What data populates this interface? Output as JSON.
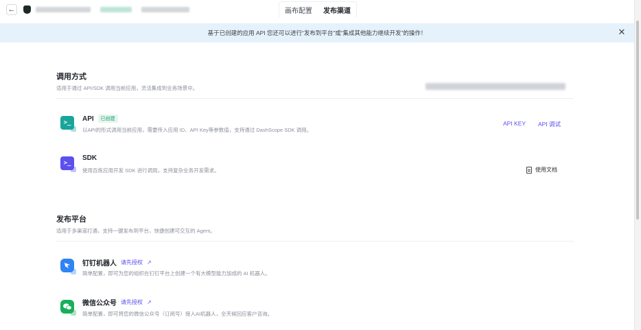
{
  "header": {
    "back_glyph": "←",
    "tabs": [
      {
        "label": "画布配置",
        "active": false
      },
      {
        "label": "发布渠道",
        "active": true
      }
    ]
  },
  "banner": {
    "text": "基于已创建的应用 API 您还可以进行“发布到平台”或“集成其他能力继续开发”的操作！",
    "close_glyph": "✕"
  },
  "invoke_section": {
    "title": "调用方式",
    "desc": "适用于通过 API/SDK 调用当前应用，灵活集成到业务场景中。",
    "items": [
      {
        "icon": "terminal-icon",
        "icon_glyph": ">_",
        "title": "API",
        "badge": "已创建",
        "desc": "以API的形式调用当前应用，需要传入应用 ID、API Key等参数值，支持通过 DashScope SDK 调用。",
        "actions": [
          "API KEY",
          "API 调试"
        ]
      },
      {
        "icon": "terminal-icon",
        "icon_glyph": ">_",
        "title": "SDK",
        "desc": "使用百炼应用开发 SDK 进行调用，支持复杂业务开发需求。",
        "doc_label": "使用文档"
      }
    ]
  },
  "publish_section": {
    "title": "发布平台",
    "desc": "适用于多渠道打通，支持一键发布到平台，快捷创建可交互的 Agent。",
    "items": [
      {
        "icon": "dingtalk-icon",
        "title": "钉钉机器人",
        "auth_label": "请先授权",
        "arrow_glyph": "↗",
        "desc": "简单配置，即可为您的组织在钉钉平台上创建一个有大模型能力加成的 AI 机器人。"
      },
      {
        "icon": "wechat-icon",
        "title": "微信公众号",
        "auth_label": "请先授权",
        "arrow_glyph": "↗",
        "desc": "简单配置，即可将您的微信公众号（订阅号）接入AI机器人，全天候回应客户咨询。"
      }
    ]
  },
  "colors": {
    "accent": "#5b4ff0",
    "banner_bg": "#e6f2fb",
    "badge_green": "#1a9a6c"
  }
}
